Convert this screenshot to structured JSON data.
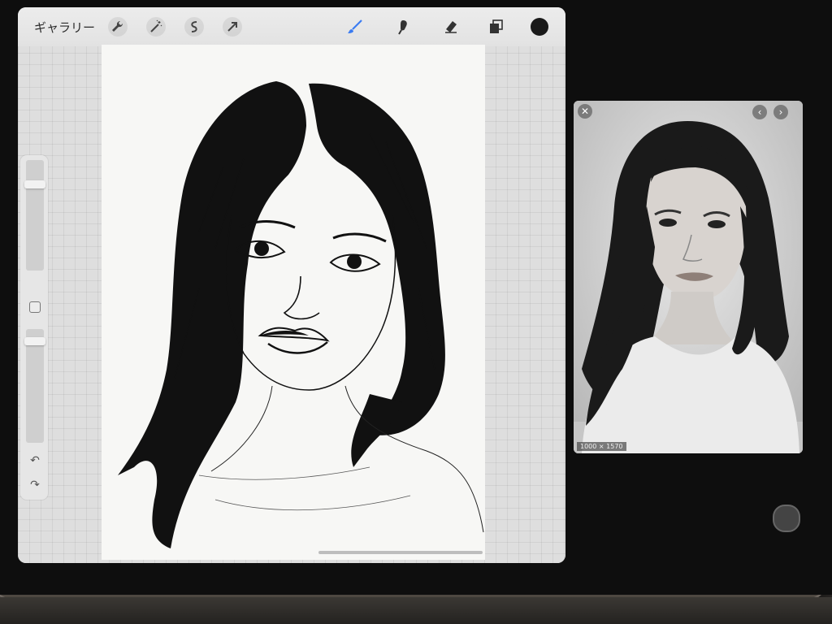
{
  "toolbar": {
    "gallery_label": "ギャラリー",
    "tools": [
      "wrench-icon",
      "magic-wand-icon",
      "selection-icon",
      "transform-icon"
    ],
    "right_tools": [
      "brush-icon",
      "smudge-icon",
      "eraser-icon",
      "layers-icon"
    ],
    "active_tool": "brush-icon",
    "active_color": "#1a1a1a",
    "accent_color": "#3b7cf2"
  },
  "side_panel": {
    "brush_size_level": 0.8,
    "opacity_level": 0.92,
    "undo_icon": "undo-icon",
    "redo_icon": "redo-icon"
  },
  "reference": {
    "dimensions_label": "1000 × 1570",
    "close_icon": "close-icon",
    "prev_icon": "chevron-left-icon",
    "next_icon": "chevron-right-icon"
  }
}
